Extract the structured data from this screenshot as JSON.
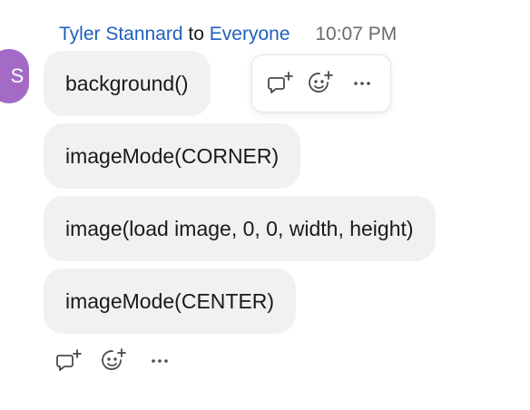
{
  "message": {
    "sender": "Tyler Stannard",
    "to_word": "to",
    "recipient": "Everyone",
    "time": "10:07 PM",
    "avatar_initial": "S",
    "lines": [
      "background()",
      "imageMode(CORNER)",
      "image(load image, 0, 0, width, height)",
      "imageMode(CENTER)"
    ]
  },
  "icons": {
    "reply": "reply-thread-icon",
    "reaction": "add-reaction-icon",
    "more": "more-options-icon"
  },
  "colors": {
    "link": "#1f5fbf",
    "avatar": "#a36ac6",
    "bubble": "#f1f1f3",
    "timestamp": "#6b6b6b"
  }
}
